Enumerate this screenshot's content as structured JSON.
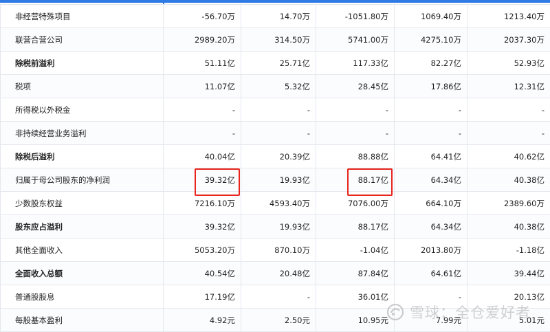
{
  "table": {
    "rows": [
      {
        "label": "非经营特殊项目",
        "bold": false,
        "values": [
          "-56.70万",
          "14.70万",
          "-1051.80万",
          "1069.40万",
          "1213.40万"
        ]
      },
      {
        "label": "联营合营公司",
        "bold": false,
        "values": [
          "2989.20万",
          "314.50万",
          "5741.00万",
          "4275.10万",
          "2037.30万"
        ]
      },
      {
        "label": "除税前溢利",
        "bold": true,
        "values": [
          "51.11亿",
          "25.71亿",
          "117.33亿",
          "82.27亿",
          "52.93亿"
        ]
      },
      {
        "label": "税项",
        "bold": false,
        "values": [
          "11.07亿",
          "5.32亿",
          "28.45亿",
          "17.86亿",
          "12.31亿"
        ]
      },
      {
        "label": "所得税以外税金",
        "bold": false,
        "values": [
          "-",
          "-",
          "-",
          "-",
          "-"
        ]
      },
      {
        "label": "非持续经营业务溢利",
        "bold": false,
        "values": [
          "-",
          "-",
          "-",
          "-",
          "-"
        ]
      },
      {
        "label": "除税后溢利",
        "bold": true,
        "values": [
          "40.04亿",
          "20.39亿",
          "88.88亿",
          "64.41亿",
          "40.62亿"
        ]
      },
      {
        "label": "归属于母公司股东的净利润",
        "bold": false,
        "values": [
          "39.32亿",
          "19.93亿",
          "88.17亿",
          "64.34亿",
          "40.38亿"
        ]
      },
      {
        "label": "少数股东权益",
        "bold": false,
        "values": [
          "7216.10万",
          "4593.40万",
          "7076.00万",
          "664.10万",
          "2389.60万"
        ]
      },
      {
        "label": "股东应占溢利",
        "bold": true,
        "values": [
          "39.32亿",
          "19.93亿",
          "88.17亿",
          "64.34亿",
          "40.38亿"
        ]
      },
      {
        "label": "其他全面收入",
        "bold": false,
        "values": [
          "5053.20万",
          "870.10万",
          "-1.04亿",
          "2013.80万",
          "-1.18亿"
        ]
      },
      {
        "label": "全面收入总额",
        "bold": true,
        "values": [
          "40.54亿",
          "20.48亿",
          "87.84亿",
          "64.61亿",
          "39.44亿"
        ]
      },
      {
        "label": "普通股股息",
        "bold": false,
        "values": [
          "17.19亿",
          "-",
          "36.01亿",
          "-",
          "20.13亿"
        ]
      },
      {
        "label": "每股基本盈利",
        "bold": false,
        "values": [
          "4.92元",
          "2.50元",
          "10.95元",
          "7.99元",
          "5.01元"
        ]
      }
    ]
  },
  "watermark": {
    "text": "雪球：全仓爱好者",
    "icon": "snowball-logo-icon"
  },
  "colors": {
    "accent": "#2e7be6",
    "highlight_border": "#e8241d",
    "grid": "#e4e7ee"
  }
}
